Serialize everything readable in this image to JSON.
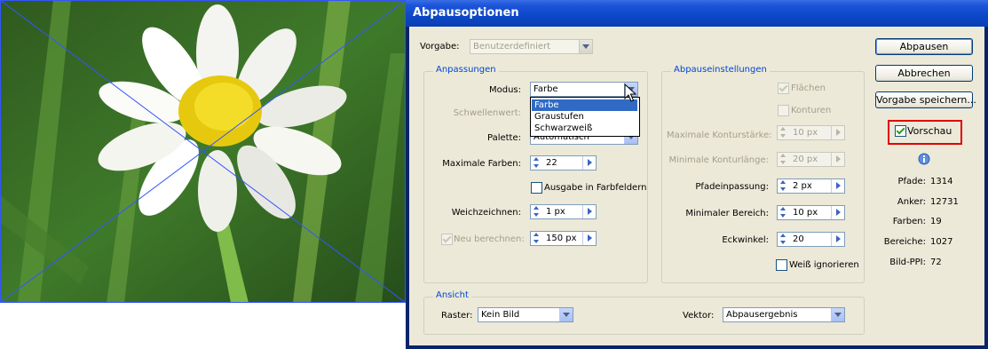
{
  "dialog": {
    "title": "Abpausoptionen",
    "preset": {
      "label": "Vorgabe:",
      "value": "Benutzerdefiniert"
    },
    "adjustments": {
      "title": "Anpassungen",
      "mode": {
        "label": "Modus:",
        "value": "Farbe",
        "options": [
          "Farbe",
          "Graustufen",
          "Schwarzweiß"
        ],
        "selected_index": 0
      },
      "threshold": {
        "label": "Schwellenwert:"
      },
      "palette": {
        "label": "Palette:",
        "value": "Automatisch"
      },
      "max_colors": {
        "label": "Maximale Farben:",
        "value": "22"
      },
      "output_swatches": {
        "label": "Ausgabe in Farbfeldern",
        "checked": false
      },
      "blur": {
        "label": "Weichzeichnen:",
        "value": "1 px"
      },
      "resample": {
        "label": "Neu berechnen:",
        "value": "150 px",
        "checked": true
      }
    },
    "trace_settings": {
      "title": "Abpauseinstellungen",
      "fills": {
        "label": "Flächen",
        "checked": true
      },
      "strokes": {
        "label": "Konturen",
        "checked": false
      },
      "max_stroke_weight": {
        "label": "Maximale Konturstärke:",
        "value": "10 px"
      },
      "min_stroke_length": {
        "label": "Minimale Konturlänge:",
        "value": "20 px"
      },
      "path_fitting": {
        "label": "Pfadeinpassung:",
        "value": "2 px"
      },
      "min_area": {
        "label": "Minimaler Bereich:",
        "value": "10 px"
      },
      "corner_angle": {
        "label": "Eckwinkel:",
        "value": "20"
      },
      "ignore_white": {
        "label": "Weiß ignorieren",
        "checked": false
      }
    },
    "view": {
      "title": "Ansicht",
      "raster": {
        "label": "Raster:",
        "value": "Kein Bild"
      },
      "vector": {
        "label": "Vektor:",
        "value": "Abpausergebnis"
      }
    },
    "buttons": {
      "trace": "Abpausen",
      "cancel": "Abbrechen",
      "save_preset": "Vorgabe speichern..."
    },
    "preview": {
      "label": "Vorschau",
      "checked": true,
      "highlight_color": "#e00000"
    },
    "stats": {
      "paths": {
        "label": "Pfade:",
        "value": "1314"
      },
      "anchors": {
        "label": "Anker:",
        "value": "12731"
      },
      "colors": {
        "label": "Farben:",
        "value": "19"
      },
      "areas": {
        "label": "Bereiche:",
        "value": "1027"
      },
      "image_ppi": {
        "label": "Bild-PPI:",
        "value": "72"
      }
    },
    "colors": {
      "accent": "#0046d5",
      "titlebar": "#0a47c8",
      "face": "#ece9d8",
      "selection": "#316ac5"
    }
  },
  "photo": {
    "subject": "daisy-photo",
    "overlay_color": "#3355ff"
  }
}
